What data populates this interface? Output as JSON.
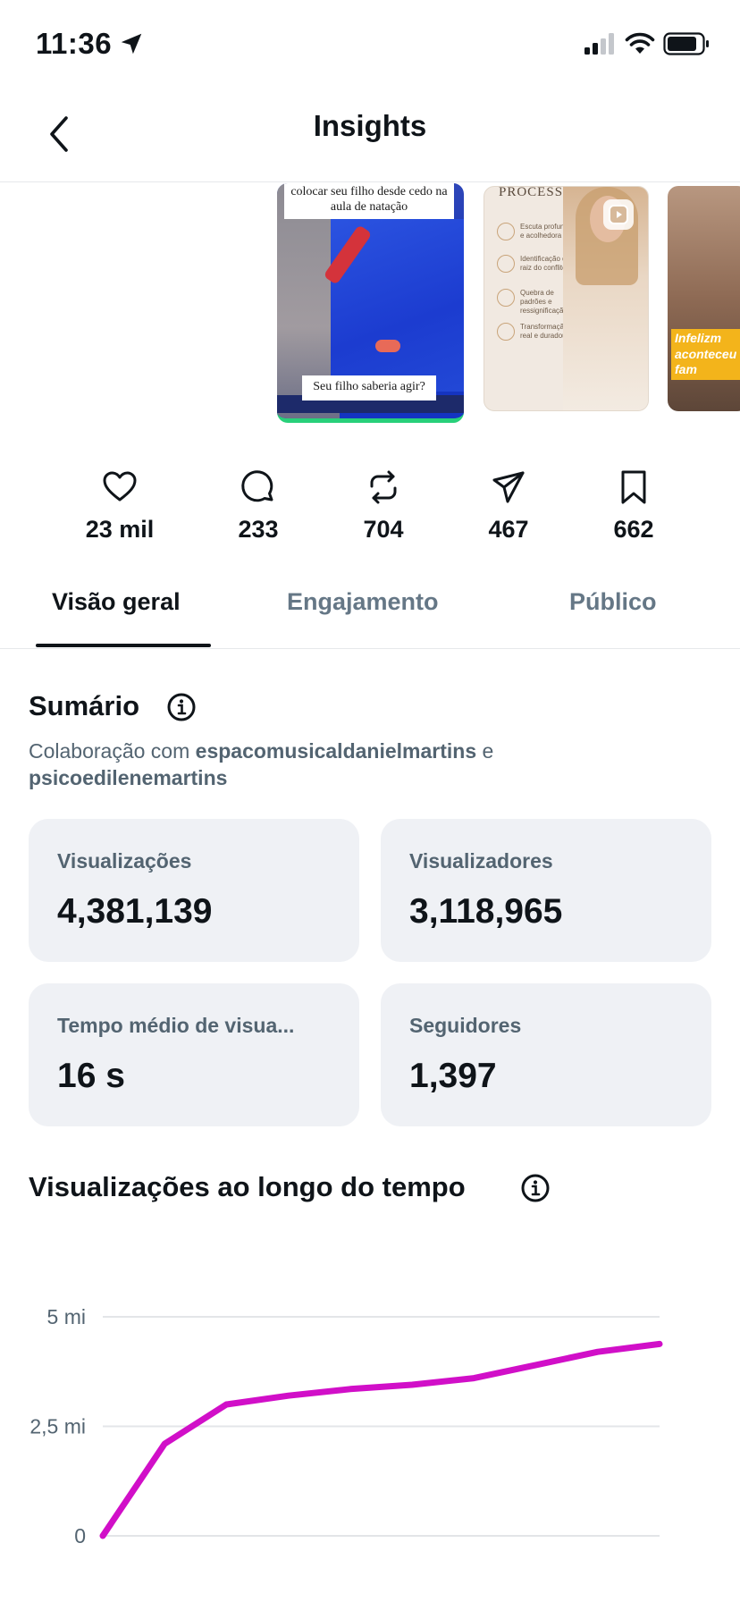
{
  "status_bar": {
    "time": "11:36"
  },
  "header": {
    "title": "Insights"
  },
  "media": {
    "pool_caption_top": "colocar seu filho desde cedo na aula de natação",
    "pool_caption_bottom": "Seu filho saberia agir?",
    "process_title": "PROCESSO",
    "process_items": [
      "Escuta profunda e acolhedora",
      "Identificação da raiz do conflito",
      "Quebra de padrões e ressignificação",
      "Transformação real e duradoura"
    ],
    "family_caption": "Infelizm aconteceu fam"
  },
  "stats": [
    {
      "icon": "heart-icon",
      "value": "23 mil"
    },
    {
      "icon": "comment-icon",
      "value": "233"
    },
    {
      "icon": "repost-icon",
      "value": "704"
    },
    {
      "icon": "share-icon",
      "value": "467"
    },
    {
      "icon": "bookmark-icon",
      "value": "662"
    }
  ],
  "tabs": [
    {
      "label": "Visão geral",
      "active": true
    },
    {
      "label": "Engajamento",
      "active": false
    },
    {
      "label": "Público",
      "active": false
    }
  ],
  "summary": {
    "title": "Sumário",
    "collab_prefix": "Colaboração com ",
    "collab_user1": "espacomusicaldanielmartins",
    "collab_joiner": " e",
    "collab_user2": "psicoedilenemartins",
    "cards": [
      {
        "label": "Visualizações",
        "value": "4,381,139"
      },
      {
        "label": "Visualizadores",
        "value": "3,118,965"
      },
      {
        "label": "Tempo médio de visua...",
        "value": "16 s"
      },
      {
        "label": "Seguidores",
        "value": "1,397"
      }
    ]
  },
  "views_over_time": {
    "title": "Visualizações ao longo do tempo"
  },
  "chart_data": {
    "type": "line",
    "title": "Visualizações ao longo do tempo",
    "y_ticks": [
      "5 mi",
      "2,5 mi",
      "0"
    ],
    "ylim": [
      0,
      5000000
    ],
    "grid": true,
    "line_color": "#d10fc8",
    "series": [
      {
        "values": [
          0,
          2100000,
          3000000,
          3200000,
          3350000,
          3450000,
          3600000,
          3900000,
          4200000,
          4380000
        ]
      }
    ]
  }
}
